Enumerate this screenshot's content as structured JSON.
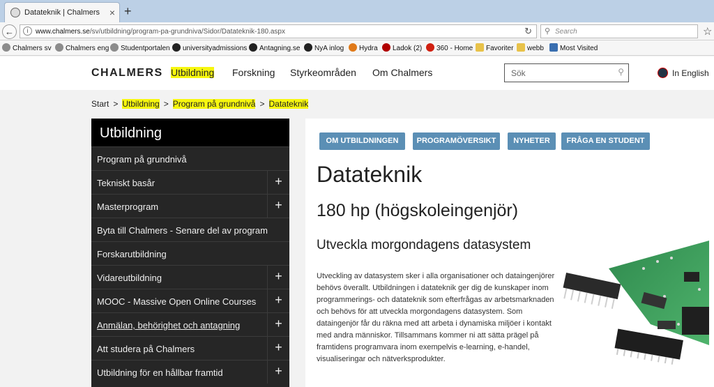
{
  "browser": {
    "tab_title": "Datateknik | Chalmers",
    "tab_close": "×",
    "new_tab": "+",
    "url_host": "www.chalmers.se",
    "url_path": "/sv/utbildning/program-pa-grundniva/Sidor/Datateknik-180.aspx",
    "search_placeholder": "Search",
    "bookmarks": [
      {
        "label": "Chalmers sv",
        "color": "#8c8c8c"
      },
      {
        "label": "Chalmers eng",
        "color": "#8c8c8c"
      },
      {
        "label": "Studentportalen",
        "color": "#8c8c8c"
      },
      {
        "label": "universityadmissions",
        "color": "#222222"
      },
      {
        "label": "Antagning.se",
        "color": "#222222"
      },
      {
        "label": "NyA inlog",
        "color": "#222222"
      },
      {
        "label": "Hydra",
        "color": "#e07a1a"
      },
      {
        "label": "Ladok (2)",
        "color": "#b00000"
      },
      {
        "label": "360 - Home",
        "color": "#d02010"
      },
      {
        "label": "Favoriter",
        "color": "#e8c24a"
      },
      {
        "label": "webb",
        "color": "#e8c24a"
      },
      {
        "label": "Most Visited",
        "color": "#3a6fb0"
      }
    ]
  },
  "site": {
    "logo": "CHALMERS",
    "nav": [
      "Utbildning",
      "Forskning",
      "Styrkeområden",
      "Om Chalmers"
    ],
    "search_placeholder": "Sök",
    "language": "In English"
  },
  "breadcrumb": [
    "Start",
    "Utbildning",
    "Program på grundnivå",
    "Datateknik"
  ],
  "sidebar": {
    "heading": "Utbildning",
    "items": [
      {
        "label": "Program på grundnivå",
        "expand": ""
      },
      {
        "label": "Tekniskt basår",
        "expand": "+"
      },
      {
        "label": "Masterprogram",
        "expand": "+"
      },
      {
        "label": "Byta till Chalmers - Senare del av program",
        "expand": ""
      },
      {
        "label": "Forskarutbildning",
        "expand": ""
      },
      {
        "label": "Vidareutbildning",
        "expand": "+"
      },
      {
        "label": "MOOC - Massive Open Online Courses",
        "expand": "+"
      },
      {
        "label": "Anmälan, behörighet och antagning",
        "expand": "+"
      },
      {
        "label": "Att studera på Chalmers",
        "expand": "+"
      },
      {
        "label": "Utbildning för en hållbar framtid",
        "expand": "+"
      }
    ]
  },
  "content": {
    "tabs": [
      "OM UTBILDNINGEN",
      "PROGRAMÖVERSIKT",
      "NYHETER",
      "FRÅGA EN STUDENT"
    ],
    "title": "Datateknik",
    "subtitle": "180 hp (högskoleingenjör)",
    "heading": "Utveckla morgondagens datasystem",
    "body": "Utveckling av datasystem sker i alla organisationer och dataingenjörer behövs överallt. Utbildningen i datateknik ger dig de kunskaper inom programmerings- och datateknik som efterfrågas av arbetsmarknaden och behövs för att utveckla morgondagens datasystem. Som dataingenjör får du räkna med att arbeta i dynamiska miljöer i kontakt med andra människor. Tillsammans kommer ni att sätta prägel på framtidens programvara inom exempelvis e-learning, e-handel, visualiseringar och nätverksprodukter."
  },
  "colors": {
    "highlight": "#f7f70f",
    "tab_button": "#5b8fb5",
    "sidebar_bg": "#262626",
    "sidebar_head": "#000000"
  }
}
